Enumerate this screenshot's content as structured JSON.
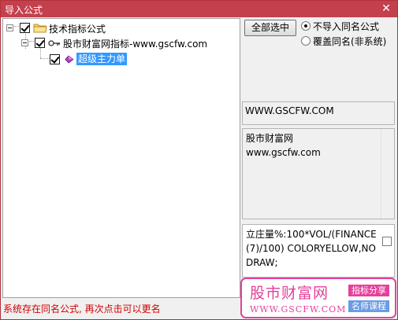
{
  "window": {
    "title": "导入公式",
    "close_label": "✕"
  },
  "tree": {
    "root_label": "技术指标公式",
    "group_label": "股市财富网指标-www.gscfw.com",
    "leaf_label": "超级主力单"
  },
  "options": {
    "select_all_label": "全部选中",
    "radio_skip_label": "不导入同名公式",
    "radio_overwrite_label": "覆盖同名(非系统)",
    "selected_option": "不导入同名公式"
  },
  "info": {
    "url": "WWW.GSCFW.COM",
    "description_line1": "股市财富网",
    "description_line2": "www.gscfw.com",
    "formula": "立庄量%:100*VOL/(FINANCE(7)/100) COLORYELLOW,NODRAW;"
  },
  "status": {
    "message": "系统存在同名公式, 再次点击可以更名"
  },
  "logo": {
    "name": "股市财富网",
    "url": "WWW.GSCFW.COM",
    "badge1": "指标分享",
    "badge2": "名师课程"
  },
  "colors": {
    "title_bar": "#c4404d",
    "status_text": "#d10000",
    "logo_pink": "#e5409a",
    "logo_blue": "#6b9be3",
    "selection": "#3399ff"
  },
  "icons": {
    "root": "folder-icon",
    "group": "key-icon",
    "leaf": "formula-gem-icon"
  }
}
